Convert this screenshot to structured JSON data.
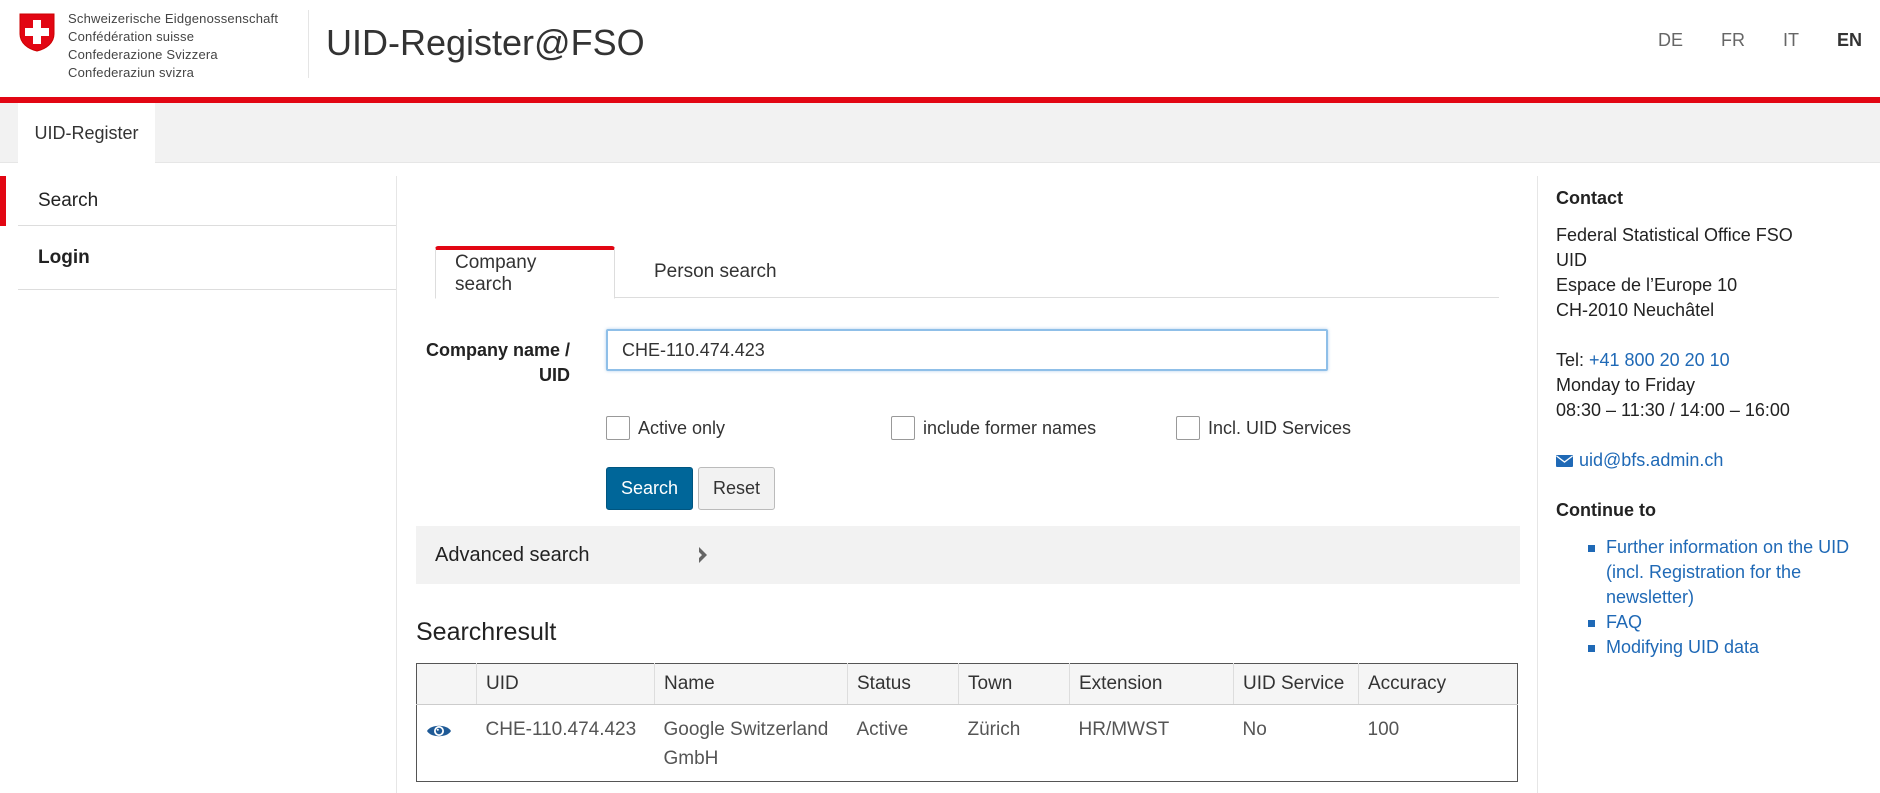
{
  "header": {
    "confederation_lines": [
      "Schweizerische Eidgenossenschaft",
      "Confédération suisse",
      "Confederazione Svizzera",
      "Confederaziun svizra"
    ],
    "app_title": "UID-Register@FSO",
    "languages": [
      "DE",
      "FR",
      "IT",
      "EN"
    ],
    "active_language": "EN",
    "accent_color": "#e20613"
  },
  "tabbar": {
    "app_tab": "UID-Register"
  },
  "nav": {
    "items": [
      {
        "label": "Search",
        "active": true
      },
      {
        "label": "Login",
        "active": false
      }
    ]
  },
  "search": {
    "tabs": [
      "Company search",
      "Person search"
    ],
    "active_tab": "Company search",
    "field_label_line1": "Company name /",
    "field_label_line2": "UID",
    "query_value": "CHE-110.474.423",
    "checkboxes": [
      {
        "label": "Active only",
        "checked": false
      },
      {
        "label": "include former names",
        "checked": false
      },
      {
        "label": "Incl. UID Services",
        "checked": false
      }
    ],
    "search_button": "Search",
    "reset_button": "Reset",
    "advanced_label": "Advanced search",
    "primary_color": "#006699"
  },
  "results": {
    "title": "Searchresult",
    "columns": [
      "UID",
      "Name",
      "Status",
      "Town",
      "Extension",
      "UID Service",
      "Accuracy"
    ],
    "rows": [
      {
        "uid": "CHE-110.474.423",
        "name_line1": "Google Switzerland",
        "name_line2": "GmbH",
        "status": "Active",
        "town": "Zürich",
        "extension": "HR/MWST",
        "uid_service": "No",
        "accuracy": "100"
      }
    ]
  },
  "contact": {
    "title": "Contact",
    "lines": [
      "Federal Statistical Office FSO",
      "UID",
      "Espace de l’Europe 10",
      "CH-2010 Neuchâtel"
    ],
    "tel_label": "Tel: ",
    "tel": "+41 800 20 20 10",
    "hours_line1": "Monday to Friday",
    "hours_line2": "08:30 – 11:30 / 14:00 – 16:00",
    "email": "uid@bfs.admin.ch",
    "link_color": "#1f69b6"
  },
  "continue": {
    "title": "Continue to",
    "links": [
      "Further information on the UID (incl. Registration for the newsletter)",
      "FAQ",
      "Modifying UID data"
    ]
  }
}
